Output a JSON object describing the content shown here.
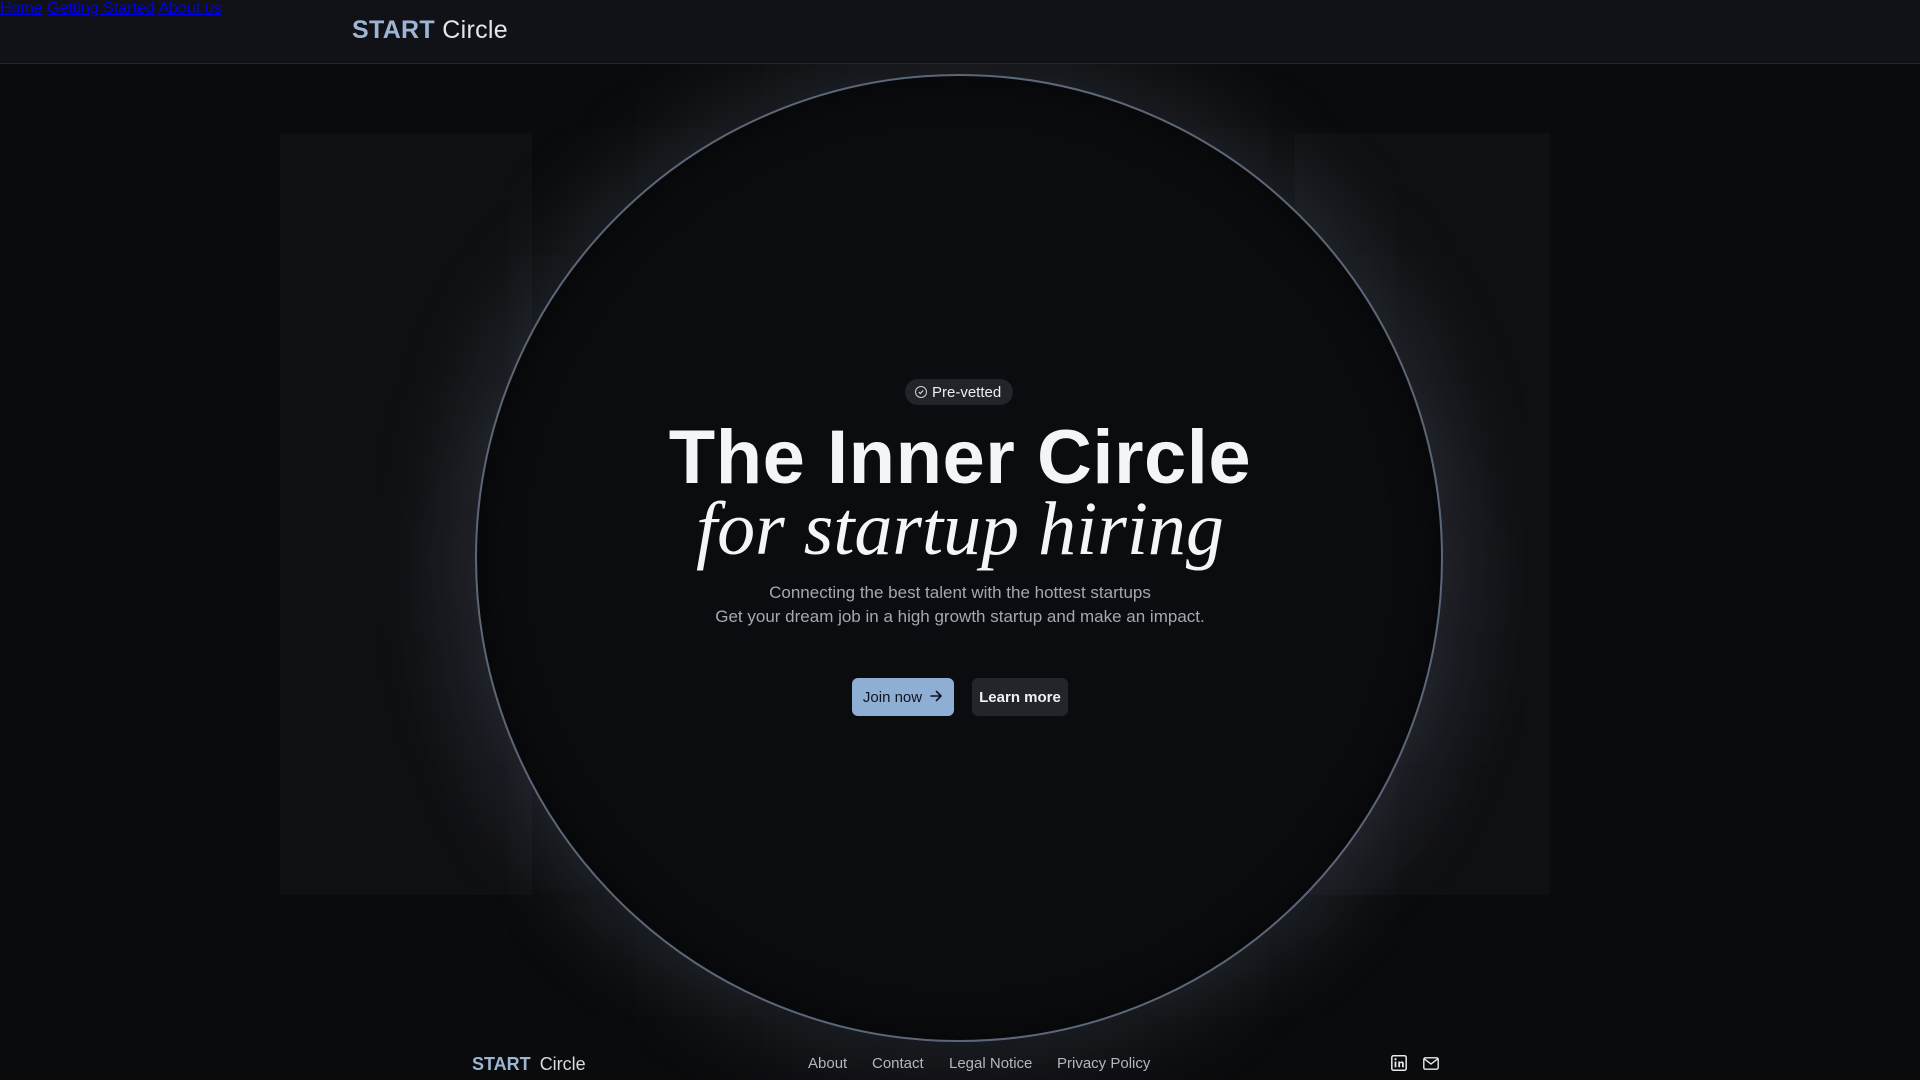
{
  "header": {
    "logo_start": "START",
    "logo_circle": "Circle",
    "nav": [
      {
        "label": "Home"
      },
      {
        "label": "Getting Started"
      },
      {
        "label": "About us"
      }
    ]
  },
  "hero": {
    "badge": "Pre-vetted",
    "badge_icon": "check-circle-icon",
    "title": "The Inner Circle",
    "subtitle": "for startup hiring",
    "desc_line1": "Connecting the best talent with the hottest startups",
    "desc_line2": "Get your dream job in a high growth startup and make an impact.",
    "join_label": "Join now",
    "join_icon": "arrow-right-icon",
    "learn_label": "Learn more"
  },
  "footer": {
    "logo_start": "START",
    "logo_circle": "Circle",
    "links": [
      {
        "label": "About"
      },
      {
        "label": "Contact"
      },
      {
        "label": "Legal Notice"
      },
      {
        "label": "Privacy Policy"
      }
    ],
    "social_icons": [
      "linkedin-icon",
      "mail-icon"
    ]
  },
  "colors": {
    "accent": "#8eaed4",
    "logo_start": "#9db5d3",
    "background": "#0a0b0d",
    "ring": "#5b6778"
  }
}
